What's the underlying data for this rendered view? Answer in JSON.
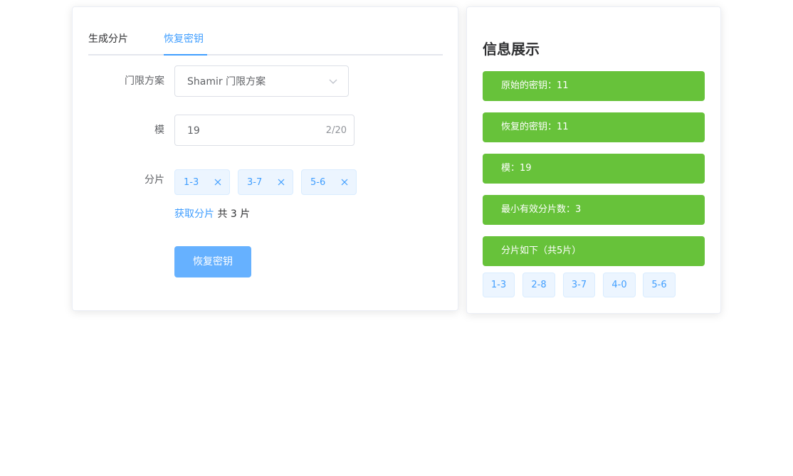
{
  "tabs": {
    "generate": "生成分片",
    "recover": "恢复密钥"
  },
  "form": {
    "scheme_label": "门限方案",
    "scheme_value": "Shamir 门限方案",
    "modulus_label": "模",
    "modulus_value": "19",
    "modulus_count": "2/20",
    "shards_label": "分片",
    "shard_tags": [
      "1-3",
      "3-7",
      "5-6"
    ],
    "get_shards_link": "获取分片",
    "total_text": " 共 3 片",
    "recover_button": "恢复密钥"
  },
  "info": {
    "title": "信息展示",
    "original_key": "原始的密钥：11",
    "recovered_key": "恢复的密钥：11",
    "modulus": "模：19",
    "min_shards": "最小有效分片数：3",
    "shards_heading": "分片如下（共5片）",
    "shards": [
      "1-3",
      "2-8",
      "3-7",
      "4-0",
      "5-6"
    ]
  },
  "colors": {
    "primary": "#409eff",
    "success": "#67c23a",
    "button": "#66b1ff"
  }
}
